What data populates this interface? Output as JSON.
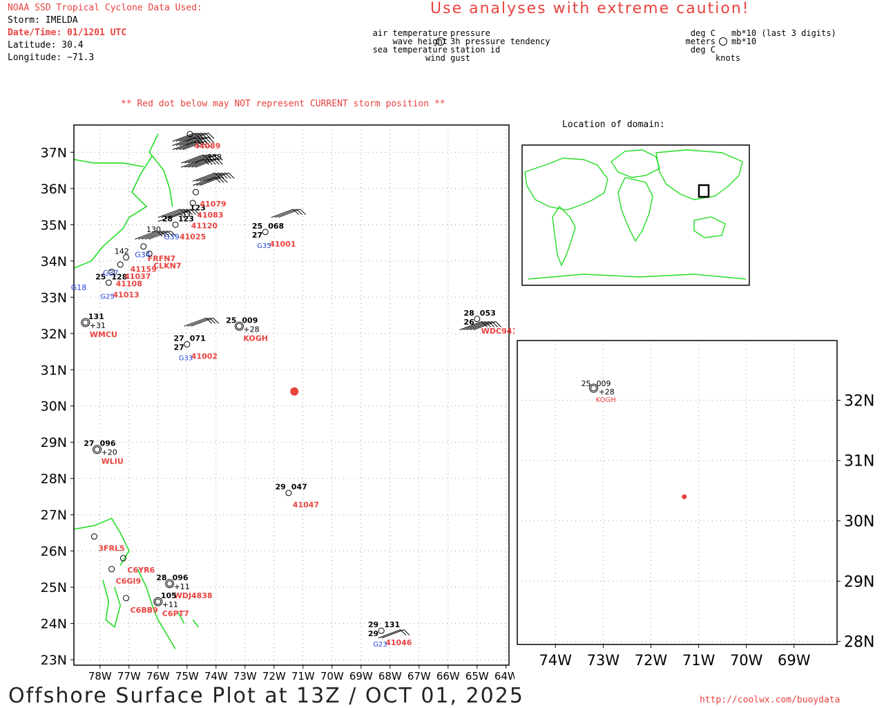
{
  "header": {
    "source_title": "NOAA SSD Tropical Cyclone Data Used:",
    "storm": "Storm: IMELDA",
    "datetime": "Date/Time: 01/1201 UTC",
    "latitude": "Latitude: 30.4",
    "longitude": "Longitude: −71.3",
    "warning": "Use analyses with extreme caution!"
  },
  "legend": {
    "left": [
      "air temperature",
      "wave height",
      "sea temperature"
    ],
    "right": [
      "pressure",
      "3h pressure tendency",
      "station id"
    ],
    "bottom": "wind gust",
    "units_left": [
      "deg C",
      "meters",
      "deg C"
    ],
    "units_right": [
      "mb*10 (last 3 digits)",
      "mb*10"
    ],
    "units_bottom": "knots"
  },
  "note": "** Red dot below may NOT represent CURRENT storm position **",
  "inset_title": "Location of domain:",
  "colors": {
    "coast": "#22dd22",
    "storm": "#e8423f",
    "station_id": "#e8423f",
    "buoy_id": "#2244dd"
  },
  "main_map": {
    "lat_labels": [
      "37N",
      "36N",
      "35N",
      "34N",
      "33N",
      "32N",
      "31N",
      "30N",
      "29N",
      "28N",
      "27N",
      "26N",
      "25N",
      "24N",
      "23N"
    ],
    "lon_labels": [
      "78W",
      "77W",
      "76W",
      "75W",
      "74W",
      "73W",
      "72W",
      "71W",
      "70W",
      "69W",
      "68W",
      "67W",
      "66W",
      "65W",
      "64W"
    ],
    "storm_position": {
      "lat": 30.4,
      "lon": -71.3
    },
    "stations": [
      {
        "id": "41001",
        "lon": -72.3,
        "lat": 34.8,
        "air": "25",
        "sea": "27",
        "pres": "068",
        "gid": "G35"
      },
      {
        "id": "41002",
        "lon": -75.0,
        "lat": 31.7,
        "air": "27",
        "sea": "27",
        "pres": "071",
        "gid": "G33"
      },
      {
        "id": "KOGH",
        "lon": -73.2,
        "lat": 32.2,
        "air": "25",
        "pres": "009",
        "tend": "+28"
      },
      {
        "id": "WMCU",
        "lon": -78.5,
        "lat": 32.3,
        "pres": "131",
        "tend": "+31"
      },
      {
        "id": "WLIU",
        "lon": -78.1,
        "lat": 28.8,
        "air": "27",
        "pres": "096",
        "tend": "+20"
      },
      {
        "id": "41047",
        "lon": -71.5,
        "lat": 27.6,
        "air": "29",
        "pres": "047"
      },
      {
        "id": "WDC9417",
        "lon": -65.0,
        "lat": 32.4,
        "air": "28",
        "sea": "26",
        "pres": "053"
      },
      {
        "id": "41046",
        "lon": -68.3,
        "lat": 23.8,
        "air": "29",
        "sea": "29",
        "pres": "131",
        "gid": "G23"
      },
      {
        "id": "WDJ4838",
        "lon": -75.6,
        "lat": 25.1,
        "air": "28",
        "pres": "096",
        "tend": "+11"
      },
      {
        "id": "C6PT7",
        "lon": -76.0,
        "lat": 24.6,
        "pres": "105",
        "tend": "+11"
      },
      {
        "id": "41013",
        "lon": -77.7,
        "lat": 33.4,
        "air": "25",
        "pres": "128",
        "gid": "G25"
      },
      {
        "id": "41025",
        "lon": -75.4,
        "lat": 35.0,
        "air": "28",
        "pres": "123"
      },
      {
        "id": "41120",
        "lon": -75.0,
        "lat": 35.3,
        "pres": "123"
      },
      {
        "id": "41083",
        "lon": -74.8,
        "lat": 35.6
      },
      {
        "id": "41079",
        "lon": -74.7,
        "lat": 35.9
      },
      {
        "id": "44089",
        "lon": -74.9,
        "lat": 37.5
      },
      {
        "id": "FRFN7",
        "lon": -76.5,
        "lat": 34.4
      },
      {
        "id": "CLKN7",
        "lon": -76.3,
        "lat": 34.2
      },
      {
        "id": "41037",
        "lon": -77.3,
        "lat": 33.9
      },
      {
        "id": "41159",
        "lon": -77.1,
        "lat": 34.1
      },
      {
        "id": "41108",
        "lon": -77.6,
        "lat": 33.7
      },
      {
        "id": "3FRL5",
        "lon": -78.2,
        "lat": 26.4
      },
      {
        "id": "C6YR6",
        "lon": -77.2,
        "lat": 25.8
      },
      {
        "id": "C6GI9",
        "lon": -77.6,
        "lat": 25.5
      },
      {
        "id": "C6BB9",
        "lon": -77.1,
        "lat": 24.7
      }
    ],
    "extra_labels": [
      {
        "text": "G39",
        "lon": -75.8,
        "lat": 34.6
      },
      {
        "text": "G34",
        "lon": -76.8,
        "lat": 34.1
      },
      {
        "text": "G37",
        "lon": -77.9,
        "lat": 33.6
      },
      {
        "text": "G18",
        "lon": -79.0,
        "lat": 33.2
      },
      {
        "text": "142",
        "lon": -77.5,
        "lat": 34.2
      },
      {
        "text": "130",
        "lon": -76.4,
        "lat": 34.8
      },
      {
        "text": "138",
        "lon": -74.3,
        "lat": 36.8
      }
    ]
  },
  "zoom_map": {
    "lat_labels": [
      "32N",
      "31N",
      "30N",
      "29N",
      "28N"
    ],
    "lon_labels": [
      "74W",
      "73W",
      "72W",
      "71W",
      "70W",
      "69W"
    ],
    "storm_position": {
      "lat": 30.4,
      "lon": -71.3
    },
    "stations": [
      {
        "id": "KOGH",
        "lon": -73.2,
        "lat": 32.2,
        "air": "25",
        "pres": "009",
        "tend": "+28"
      }
    ]
  },
  "footer": {
    "title": "Offshore Surface Plot at 13Z / OCT 01, 2025",
    "url": "http://coolwx.com/buoydata"
  }
}
